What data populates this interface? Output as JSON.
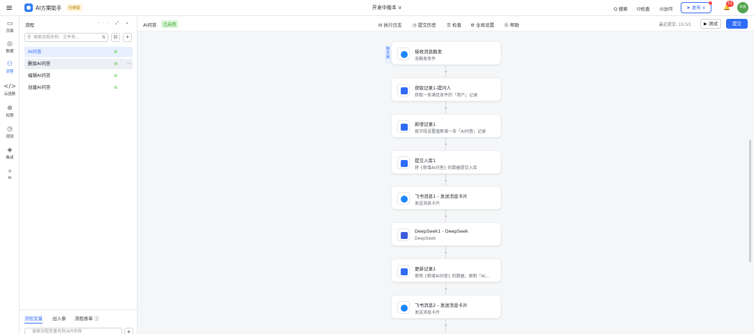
{
  "app": {
    "menu_icon": "hamburger-icon",
    "name": "AI方案助手",
    "badge": "付费版",
    "center_title": "开发中版本 ∨"
  },
  "topbar": {
    "search": "Q 搜索",
    "check": "检查",
    "visit": "访问",
    "publish": "发布",
    "notif_count": "11",
    "avatar_text": "轨道"
  },
  "rail": [
    {
      "icon": "page-icon",
      "glyph": "▭",
      "label": "页面"
    },
    {
      "icon": "database-icon",
      "glyph": "◎",
      "label": "数据"
    },
    {
      "icon": "flow-icon",
      "glyph": "⚇",
      "label": "流程"
    },
    {
      "icon": "code-icon",
      "glyph": "</>",
      "label": "云函数"
    },
    {
      "icon": "permission-icon",
      "glyph": "⊕",
      "label": "权限"
    },
    {
      "icon": "monitor-icon",
      "glyph": "◷",
      "label": "观测"
    },
    {
      "icon": "integration-icon",
      "glyph": "◈",
      "label": "集成"
    },
    {
      "icon": "ai-icon",
      "glyph": "✧",
      "label": "AI"
    }
  ],
  "panel": {
    "title": "流程",
    "tools": "··· ⤢ «",
    "search_placeholder": "搜索流程名称、文件夹...",
    "items": [
      {
        "label": "AI问答",
        "ok": "⊘"
      },
      {
        "label": "删除AI问答",
        "ok": "⊘",
        "more": "···"
      },
      {
        "label": "编辑AI问答",
        "ok": "⊘"
      },
      {
        "label": "创建AI问答",
        "ok": "⊘"
      }
    ],
    "bottom_tabs": [
      "流程变量",
      "出入参",
      "流程表单 ⓘ"
    ],
    "bottom_search": "搜索流程变量名称/API名称"
  },
  "subbar": {
    "flow_name": "AI问答",
    "status": "已启用",
    "tools": [
      "⊟ 执行日志",
      "◷ 提交历史",
      "☰ 检查",
      "⚙ 全局设置",
      "⓪ 帮助"
    ],
    "saved": "最近提交: 15:53",
    "test": "▶ 测试",
    "submit": "提交"
  },
  "trigger_tag": "触发器",
  "nodes": [
    {
      "title": "接收消息触发",
      "desc": "无触发条件",
      "icon": "feishu-icon",
      "color": "#1f86ff"
    },
    {
      "title": "获取记录1-提问人",
      "desc": "获取一条满足条件的「用户」记录",
      "icon": "record-search-icon",
      "color": "#2f6bf5"
    },
    {
      "title": "新增记录1",
      "desc": "按字段设置值新增一条「AI问答」记录",
      "icon": "record-add-icon",
      "color": "#2f6bf5"
    },
    {
      "title": "提交入库1",
      "desc": "将 {新增AI问答} 的数据提交入库",
      "icon": "record-submit-icon",
      "color": "#2f6bf5"
    },
    {
      "title": "飞书消息1 - 发送消息卡片",
      "desc": "发送消息卡片",
      "icon": "feishu-icon",
      "color": "#1f86ff"
    },
    {
      "title": "DeepSeek1 - DeepSeek",
      "desc": "DeepSeek",
      "icon": "deepseek-icon",
      "color": "#3d5bd9"
    },
    {
      "title": "更新记录1",
      "desc": "使用 {新增AI问答} 的数据，更新「AI...",
      "icon": "record-update-icon",
      "color": "#2f6bf5"
    },
    {
      "title": "飞书消息2 - 发送消息卡片",
      "desc": "发送消息卡片",
      "icon": "feishu-icon",
      "color": "#1f86ff"
    }
  ]
}
